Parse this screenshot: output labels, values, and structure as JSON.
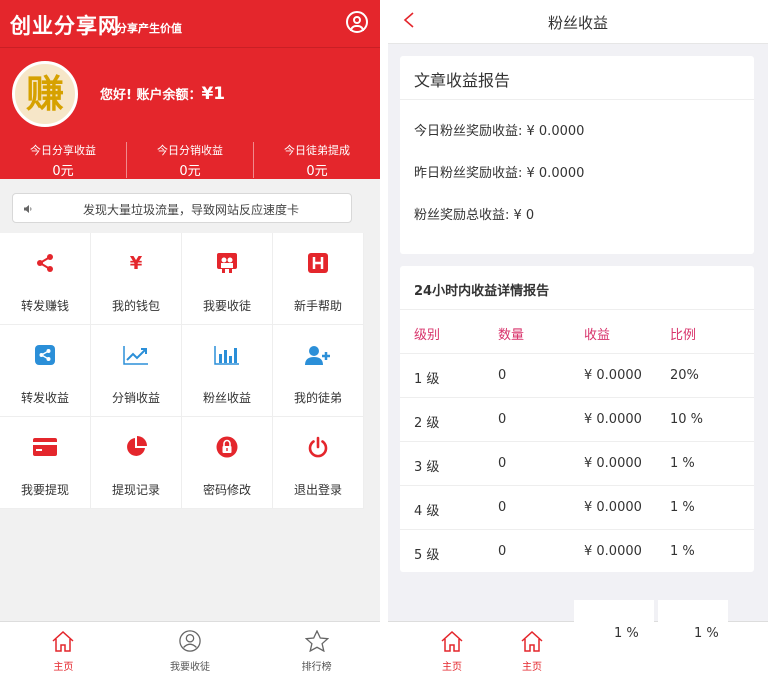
{
  "left": {
    "brand": "创业分享网",
    "slogan": "分享产生价值",
    "logo_char": "赚",
    "greeting": "您好! 账户余额：",
    "balance": "¥1",
    "stats": [
      {
        "label": "今日分享收益",
        "value": "0元"
      },
      {
        "label": "今日分销收益",
        "value": "0元"
      },
      {
        "label": "今日徒弟提成",
        "value": "0元"
      }
    ],
    "notice": "发现大量垃圾流量，导致网站反应速度卡",
    "grid": [
      {
        "label": "转发赚钱",
        "icon": "share-icon"
      },
      {
        "label": "我的钱包",
        "icon": "yen-icon"
      },
      {
        "label": "我要收徒",
        "icon": "people-icon"
      },
      {
        "label": "新手帮助",
        "icon": "help-icon"
      },
      {
        "label": "转发收益",
        "icon": "share-box-icon"
      },
      {
        "label": "分销收益",
        "icon": "trend-icon"
      },
      {
        "label": "粉丝收益",
        "icon": "bar-chart-icon"
      },
      {
        "label": "我的徒弟",
        "icon": "add-user-icon"
      },
      {
        "label": "我要提现",
        "icon": "card-icon"
      },
      {
        "label": "提现记录",
        "icon": "pie-icon"
      },
      {
        "label": "密码修改",
        "icon": "lock-icon"
      },
      {
        "label": "退出登录",
        "icon": "power-icon"
      }
    ],
    "footer": [
      {
        "label": "主页",
        "icon": "home-icon"
      },
      {
        "label": "我要收徒",
        "icon": "user-icon"
      },
      {
        "label": "排行榜",
        "icon": "star-icon"
      }
    ],
    "colors": {
      "primary": "#e4262c",
      "accent": "#d8336b"
    }
  },
  "right": {
    "title": "粉丝收益",
    "report1": {
      "title": "文章收益报告",
      "rows": [
        "今日粉丝奖励收益: ¥ 0.0000",
        "昨日粉丝奖励收益: ¥ 0.0000",
        "粉丝奖励总收益: ¥ 0"
      ]
    },
    "report2": {
      "title": "24小时内收益详情报告",
      "headers": [
        "级别",
        "数量",
        "收益",
        "比例"
      ],
      "rows": [
        [
          "1 级",
          "0",
          "¥ 0.0000",
          "20%"
        ],
        [
          "2 级",
          "0",
          "¥ 0.0000",
          "10 %"
        ],
        [
          "3 级",
          "0",
          "¥ 0.0000",
          "1 %"
        ],
        [
          "4 级",
          "0",
          "¥ 0.0000",
          "1 %"
        ],
        [
          "5 级",
          "0",
          "¥ 0.0000",
          "1 %"
        ]
      ]
    },
    "footer": [
      {
        "label": "主页",
        "icon": "home-icon"
      },
      {
        "label": "主页",
        "icon": "home-icon"
      }
    ],
    "overflow_cells": [
      "1 %",
      "1 %"
    ]
  }
}
